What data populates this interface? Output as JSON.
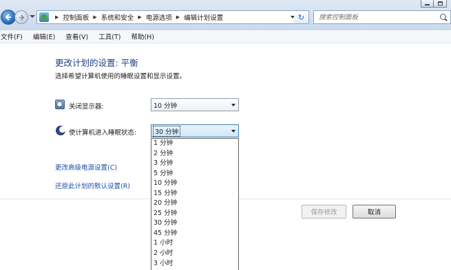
{
  "window": {
    "minimize_icon": "minimize-icon",
    "maximize_icon": "maximize-icon"
  },
  "address_bar": {
    "breadcrumbs": [
      "控制面板",
      "系统和安全",
      "电源选项",
      "编辑计划设置"
    ],
    "separator": "▶",
    "refresh_glyph": "↻",
    "location_icon": "control-panel-icon"
  },
  "search": {
    "placeholder": "搜索控制面板"
  },
  "menu": {
    "items": [
      "文件(F)",
      "编辑(E)",
      "查看(V)",
      "工具(T)",
      "帮助(H)"
    ]
  },
  "main": {
    "title": "更改计划的设置: 平衡",
    "subtitle": "选择希望计算机使用的睡眠设置和显示设置。",
    "display_off": {
      "icon": "monitor-clock-icon",
      "label": "关闭显示器:",
      "value": "10 分钟"
    },
    "sleep": {
      "icon": "moon-icon",
      "label": "使计算机进入睡眠状态:",
      "value": "30 分钟",
      "options": [
        "1 分钟",
        "2 分钟",
        "3 分钟",
        "5 分钟",
        "10 分钟",
        "15 分钟",
        "20 分钟",
        "25 分钟",
        "30 分钟",
        "45 分钟",
        "1 小时",
        "2 小时",
        "3 小时"
      ]
    },
    "links": {
      "advanced": "更改高级电源设置(C)",
      "restore": "还原此计划的默认设置(R)"
    }
  },
  "buttons": {
    "save": "保存修改",
    "cancel": "取消"
  },
  "colors": {
    "title": "#1f3d8a",
    "link": "#1a4fa6"
  }
}
